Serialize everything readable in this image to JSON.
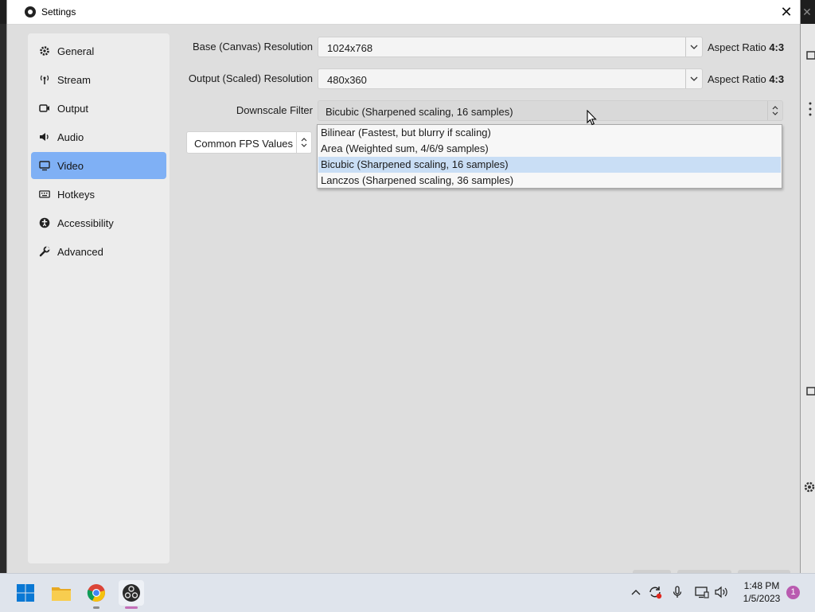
{
  "window": {
    "title": "Settings",
    "close_label": "✕"
  },
  "sidebar": {
    "items": [
      {
        "label": "General",
        "icon": "gear-icon",
        "active": false
      },
      {
        "label": "Stream",
        "icon": "broadcast-icon",
        "active": false
      },
      {
        "label": "Output",
        "icon": "output-icon",
        "active": false
      },
      {
        "label": "Audio",
        "icon": "speaker-icon",
        "active": false
      },
      {
        "label": "Video",
        "icon": "monitor-icon",
        "active": true
      },
      {
        "label": "Hotkeys",
        "icon": "keyboard-icon",
        "active": false
      },
      {
        "label": "Accessibility",
        "icon": "accessibility-icon",
        "active": false
      },
      {
        "label": "Advanced",
        "icon": "wrench-icon",
        "active": false
      }
    ]
  },
  "video": {
    "base_resolution": {
      "label": "Base (Canvas) Resolution",
      "value": "1024x768",
      "aspect_prefix": "Aspect Ratio",
      "aspect_value": "4:3"
    },
    "output_resolution": {
      "label": "Output (Scaled) Resolution",
      "value": "480x360",
      "aspect_prefix": "Aspect Ratio",
      "aspect_value": "4:3"
    },
    "downscale_filter": {
      "label": "Downscale Filter",
      "value": "Bicubic (Sharpened scaling, 16 samples)",
      "options": [
        "Bilinear (Fastest, but blurry if scaling)",
        "Area (Weighted sum, 4/6/9 samples)",
        "Bicubic (Sharpened scaling, 16 samples)",
        "Lanczos (Sharpened scaling, 36 samples)"
      ],
      "selected_index": 2
    },
    "fps": {
      "value": "Common FPS Values"
    }
  },
  "taskbar": {
    "apps": [
      "windows-start-icon",
      "file-explorer-icon",
      "chrome-icon",
      "obs-icon"
    ],
    "clock_time": "1:48 PM",
    "clock_date": "1/5/2023",
    "notification_count": "1"
  },
  "colors": {
    "accent": "#7fb0f5",
    "selection": "#c9def5",
    "badge": "#b95bb0"
  }
}
